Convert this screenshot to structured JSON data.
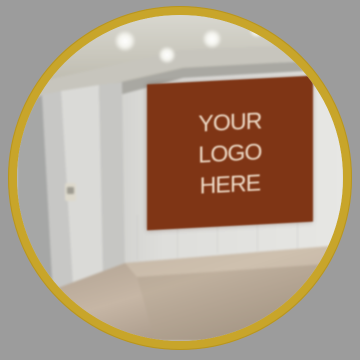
{
  "scene": {
    "description_type": "room-photo-mockup",
    "logo_panel": {
      "text": "YOUR LOGO HERE",
      "color": "#7f3515",
      "text_color": "#efdcc8"
    },
    "frame": {
      "ring_color": "#c8a52a",
      "outside_background": "#9c9c9c"
    }
  }
}
